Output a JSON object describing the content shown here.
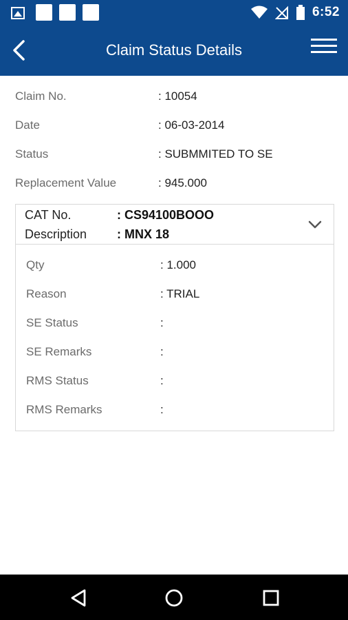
{
  "status_bar": {
    "time": "6:52",
    "icons": [
      "image-icon",
      "notification-square-icon",
      "notification-square-icon",
      "notification-square-icon",
      "wifi-icon",
      "no-signal-icon",
      "battery-icon"
    ]
  },
  "app_bar": {
    "title": "Claim Status Details",
    "back_icon": "back-chevron-icon",
    "menu_icon": "hamburger-menu-icon"
  },
  "claim": {
    "fields": [
      {
        "label": "Claim No.",
        "value": ": 10054"
      },
      {
        "label": "Date",
        "value": ": 06-03-2014"
      },
      {
        "label": "Status",
        "value": ": SUBMMITED TO SE"
      },
      {
        "label": "Replacement Value",
        "value": ": 945.000"
      }
    ]
  },
  "item_card": {
    "header": [
      {
        "label": "CAT No.",
        "value": ": CS94100BOOO"
      },
      {
        "label": "Description",
        "value": ": MNX 18"
      }
    ],
    "expand_icon": "chevron-down-icon",
    "details": [
      {
        "label": "Qty",
        "value": ": 1.000"
      },
      {
        "label": "Reason",
        "value": ": TRIAL"
      },
      {
        "label": "SE Status",
        "value": ":"
      },
      {
        "label": "SE Remarks",
        "value": ":"
      },
      {
        "label": "RMS Status",
        "value": ":"
      },
      {
        "label": "RMS Remarks",
        "value": ":"
      }
    ]
  },
  "nav_bar": {
    "buttons": [
      "back-triangle-icon",
      "home-circle-icon",
      "recents-square-icon"
    ]
  },
  "colors": {
    "primary": "#0d4a8e",
    "label_gray": "#6b6b6b",
    "value_dark": "#1f1f1f",
    "border": "#d8d8d8",
    "nav_bg": "#000000"
  }
}
